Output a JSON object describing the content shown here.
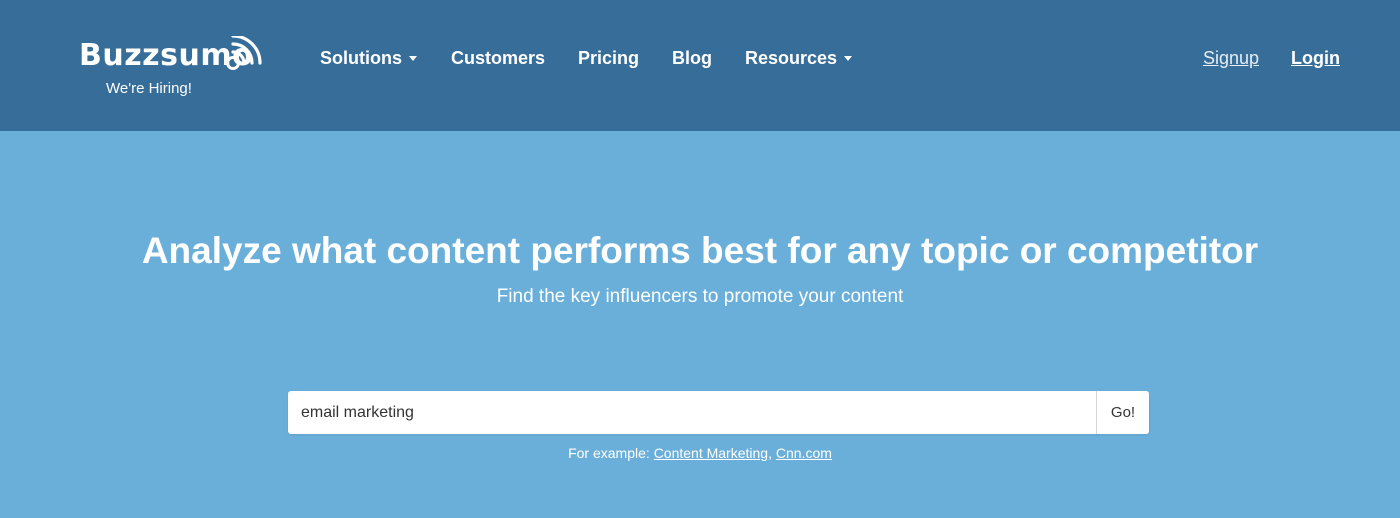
{
  "header": {
    "logo_text": "Buzzsumo",
    "hiring_label": "We're Hiring!",
    "nav": [
      {
        "label": "Solutions",
        "has_dropdown": true
      },
      {
        "label": "Customers",
        "has_dropdown": false
      },
      {
        "label": "Pricing",
        "has_dropdown": false
      },
      {
        "label": "Blog",
        "has_dropdown": false
      },
      {
        "label": "Resources",
        "has_dropdown": true
      }
    ],
    "signup_label": "Signup",
    "login_label": "Login"
  },
  "hero": {
    "title": "Analyze what content performs best for any topic or competitor",
    "subtitle": "Find the key influencers to promote your content"
  },
  "search": {
    "value": "email marketing",
    "button_label": "Go!"
  },
  "examples": {
    "prefix": "For example: ",
    "links": [
      "Content Marketing",
      "Cnn.com"
    ],
    "separator": ", "
  },
  "colors": {
    "header_bg": "#376d99",
    "page_bg": "#6aafd9"
  }
}
